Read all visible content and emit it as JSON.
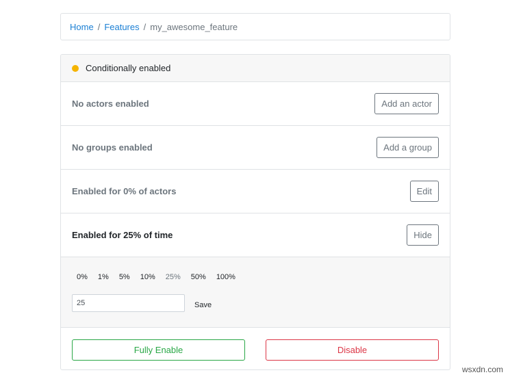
{
  "breadcrumb": {
    "home": "Home",
    "features": "Features",
    "current": "my_awesome_feature",
    "separator": "/"
  },
  "status": {
    "text": "Conditionally enabled",
    "color": "#f5b400"
  },
  "gates": {
    "actors": {
      "label": "No actors enabled",
      "button": "Add an actor"
    },
    "groups": {
      "label": "No groups enabled",
      "button": "Add a group"
    },
    "percent_actors": {
      "label": "Enabled for 0% of actors",
      "button": "Edit"
    },
    "percent_time": {
      "label": "Enabled for 25% of time",
      "button": "Hide"
    }
  },
  "percent_options": [
    "0%",
    "1%",
    "5%",
    "10%",
    "25%",
    "50%",
    "100%"
  ],
  "percent_selected": "25%",
  "percent_input": {
    "value": "25"
  },
  "save_label": "Save",
  "actions": {
    "enable": "Fully Enable",
    "disable": "Disable"
  },
  "colors": {
    "link": "#1a7fd4",
    "success": "#28a745",
    "danger": "#dc3545"
  },
  "watermark": "wsxdn.com"
}
